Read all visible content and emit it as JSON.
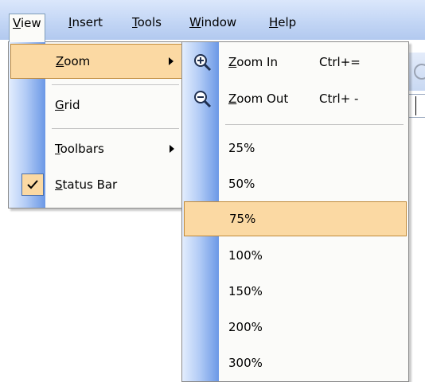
{
  "menubar": {
    "items": [
      {
        "label": "View",
        "accel": "V",
        "rest": "iew",
        "active": true
      },
      {
        "label": "Insert",
        "accel": "I",
        "rest": "nsert",
        "active": false
      },
      {
        "label": "Tools",
        "accel": "T",
        "rest": "ools",
        "active": false
      },
      {
        "label": "Window",
        "accel": "W",
        "rest": "indow",
        "active": false
      },
      {
        "label": "Help",
        "accel": "H",
        "rest": "elp",
        "active": false
      }
    ]
  },
  "view_menu": {
    "items": [
      {
        "id": "zoom",
        "accel": "Z",
        "rest": "oom",
        "label": "Zoom",
        "submenu": true,
        "highlighted": true
      },
      {
        "id": "grid",
        "accel": "G",
        "rest": "rid",
        "label": "Grid",
        "submenu": false
      },
      {
        "id": "toolbars",
        "accel": "T",
        "rest": "oolbars",
        "label": "Toolbars",
        "submenu": true
      },
      {
        "id": "status_bar",
        "accel": "S",
        "rest": "tatus Bar",
        "label": "Status Bar",
        "checked": true
      }
    ]
  },
  "zoom_menu": {
    "zoom_in": {
      "accel": "Z",
      "rest": "oom In",
      "label": "Zoom In",
      "shortcut": "Ctrl+=",
      "icon": "zoom-in-icon"
    },
    "zoom_out": {
      "accel": "Z",
      "rest": "oom Out",
      "label": "Zoom Out",
      "shortcut": "Ctrl+ -",
      "icon": "zoom-out-icon"
    },
    "levels": [
      "25%",
      "50%",
      "75%",
      "100%",
      "150%",
      "200%",
      "300%"
    ],
    "highlighted_level": "75%"
  },
  "colors": {
    "highlight_fill": "#fbd9a3",
    "highlight_border": "#c08a3a",
    "menubar_gradient": "#c3d6f5",
    "gutter_blue": "#6b98e6"
  }
}
